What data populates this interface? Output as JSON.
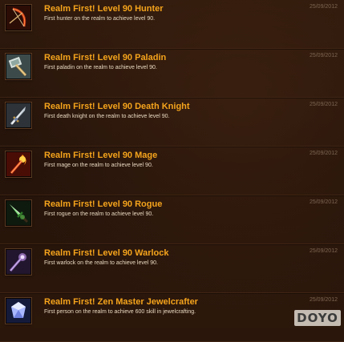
{
  "achievements": [
    {
      "title": "Realm First! Level 90 Hunter",
      "description": "First hunter on the realm to achieve level 90.",
      "date": "25/09/2012",
      "icon": "hunter-bow-icon"
    },
    {
      "title": "Realm First! Level 90 Paladin",
      "description": "First paladin on the realm to achieve level 90.",
      "date": "25/09/2012",
      "icon": "paladin-hammer-icon"
    },
    {
      "title": "Realm First! Level 90 Death Knight",
      "description": "First death knight on the realm to achieve level 90.",
      "date": "25/09/2012",
      "icon": "death-knight-sword-icon"
    },
    {
      "title": "Realm First! Level 90 Mage",
      "description": "First mage on the realm to achieve level 90.",
      "date": "25/09/2012",
      "icon": "mage-fire-staff-icon"
    },
    {
      "title": "Realm First! Level 90 Rogue",
      "description": "First rogue on the realm to achieve level 90.",
      "date": "25/09/2012",
      "icon": "rogue-dagger-icon"
    },
    {
      "title": "Realm First! Level 90 Warlock",
      "description": "First warlock on the realm to achieve level 90.",
      "date": "25/09/2012",
      "icon": "warlock-staff-icon"
    },
    {
      "title": "Realm First! Zen Master Jewelcrafter",
      "description": "First person on the realm to achieve 600 skill in jewelcrafting.",
      "date": "25/09/2012",
      "icon": "jewel-gem-icon"
    }
  ],
  "watermark": "DOYO",
  "colors": {
    "title": "#f5a41c",
    "description": "#e8d8c0",
    "date": "#7d6652",
    "background": "#2a160b"
  }
}
